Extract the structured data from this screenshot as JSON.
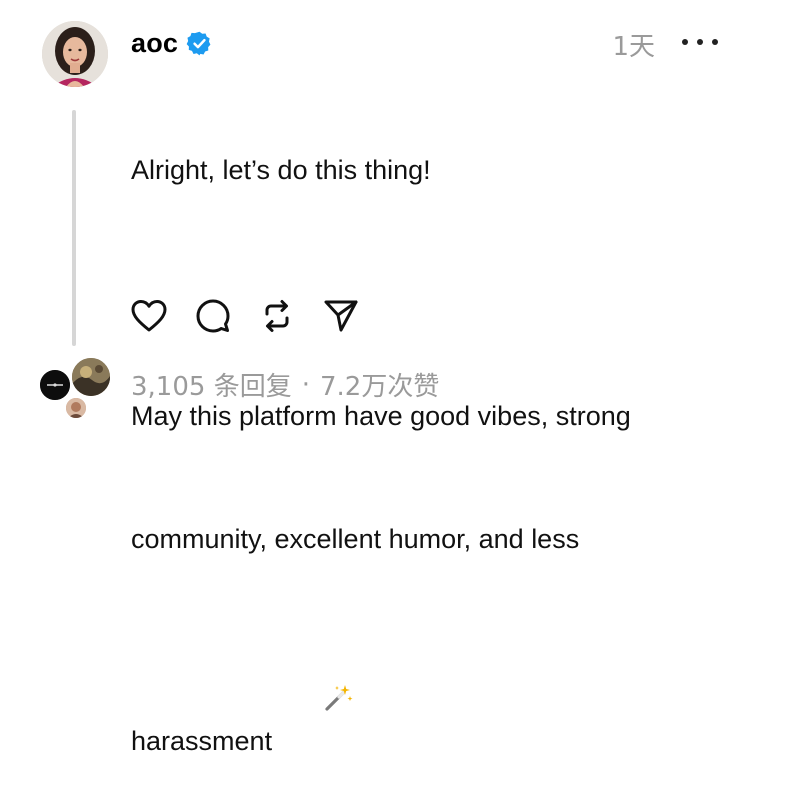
{
  "post": {
    "username": "aoc",
    "verified": true,
    "time": "1天",
    "lines": [
      "Alright, let’s do this thing!",
      "May this platform have good vibes, strong",
      "community, excellent humor, and less",
      "harassment"
    ],
    "emoji_icon": "magic-wand-icon"
  },
  "actions": {
    "like_icon": "heart-icon",
    "reply_icon": "comment-bubble-icon",
    "repost_icon": "repost-icon",
    "share_icon": "send-icon"
  },
  "stats": {
    "replies": "3,105 条回复",
    "separator": "·",
    "likes": "7.2万次赞"
  },
  "colors": {
    "verified_blue": "#1d9bf0",
    "muted_text": "#9a9a9a",
    "thread_line": "#d6d6d6"
  }
}
